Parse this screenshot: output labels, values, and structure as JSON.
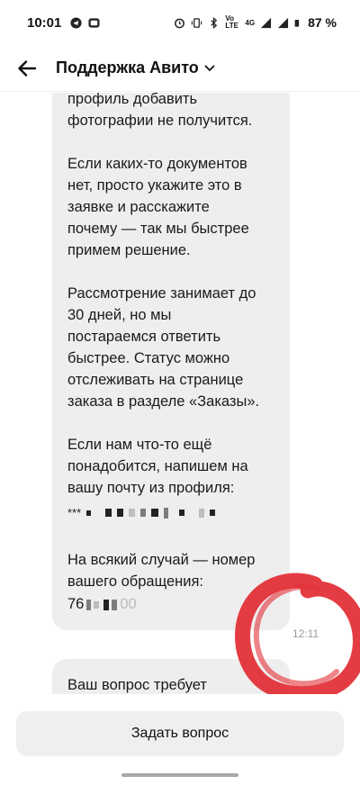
{
  "status": {
    "time": "10:01",
    "net_label": "Vo LTE",
    "signal_label": "4G",
    "battery": "87 %"
  },
  "header": {
    "title": "Поддержка Авито"
  },
  "chat": {
    "message1": {
      "text": "письмом на почту. Через\nпрофиль добавить\nфотографии не получится.\n\nЕсли каких-то документов\nнет, просто укажите это в\nзаявке и расскажите\nпочему — так мы быстрее\nпримем решение.\n\nРассмотрение занимает до\n30 дней, но мы\nпостараемся ответить\nбыстрее. Статус можно\nотслеживать на странице\nзаказа в разделе «Заказы».\n\nЕсли нам что-то ещё\nпонадобится, напишем на\nвашу почту из профиля:",
      "email_prefix": "***",
      "text_after": "На всякий случай — номер\nвашего обращения:",
      "ticket_prefix": "76",
      "ticket_suffix": "00",
      "time": "12:11"
    },
    "message2": {
      "text": "Ваш вопрос требует"
    }
  },
  "bottom": {
    "ask_button": "Задать вопрос"
  },
  "colors": {
    "bubble": "#efeeee",
    "annotation": "#e0282f"
  }
}
